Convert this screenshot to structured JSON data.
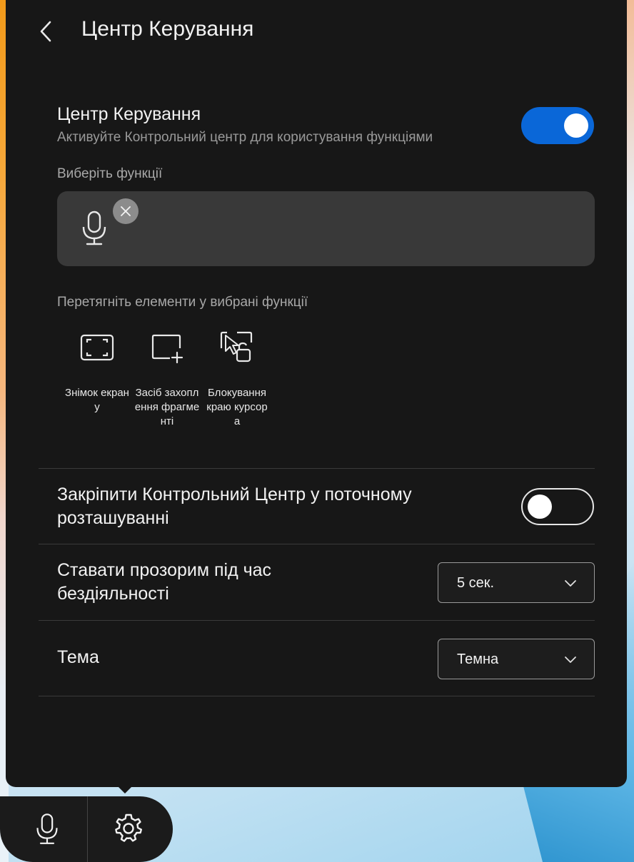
{
  "header": {
    "title": "Центр Керування"
  },
  "control_center": {
    "title": "Центр Керування",
    "description": "Активуйте Контрольний центр для користування функціями",
    "enabled": true
  },
  "selected_features": {
    "label": "Виберіть функції",
    "items": [
      {
        "icon": "microphone-icon"
      }
    ]
  },
  "available_features": {
    "label": "Перетягніть елементи у вибрані функції",
    "items": [
      {
        "icon": "screenshot-icon",
        "label": "Знімок екрану"
      },
      {
        "icon": "snipping-tool-icon",
        "label": "Засіб захоплення фрагменті"
      },
      {
        "icon": "cursor-edge-lock-icon",
        "label": "Блокування краю курсора"
      }
    ]
  },
  "pin_setting": {
    "label": "Закріпити Контрольний Центр у поточному розташуванні",
    "enabled": false
  },
  "transparency_setting": {
    "label": "Ставати прозорим під час бездіяльності",
    "value": "5 сек."
  },
  "theme_setting": {
    "label": "Тема",
    "value": "Темна"
  },
  "taskbar": {
    "items": [
      {
        "icon": "microphone-icon"
      },
      {
        "icon": "gear-icon"
      }
    ]
  },
  "colors": {
    "panel_bg": "#171717",
    "accent": "#0a67d8",
    "selected_box_bg": "#393939"
  }
}
